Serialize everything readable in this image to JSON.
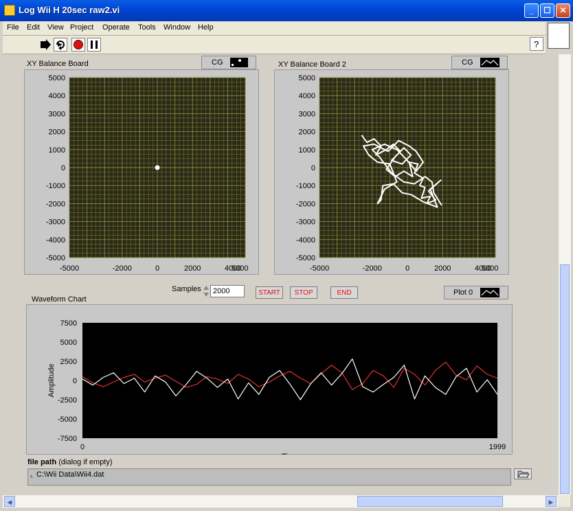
{
  "window": {
    "title": "Log Wii H 20sec raw2.vi",
    "controls": [
      "minimize-icon",
      "maximize-icon",
      "close-icon"
    ]
  },
  "menu": [
    "File",
    "Edit",
    "View",
    "Project",
    "Operate",
    "Tools",
    "Window",
    "Help"
  ],
  "toolbar": {
    "icons": [
      "run-arrow-icon",
      "run-continuously-icon",
      "abort-icon",
      "pause-icon"
    ],
    "help_icon": "help-icon"
  },
  "graph1": {
    "label": "XY Balance Board",
    "legend": "CG",
    "legend_icon": "point-plot-icon"
  },
  "graph2": {
    "label": "XY Balance Board 2",
    "legend": "CG",
    "legend_icon": "line-plot-icon"
  },
  "samples": {
    "label": "Samples",
    "value": "2000"
  },
  "buttons": {
    "start": "START",
    "stop": "STOP",
    "end": "END"
  },
  "waveform": {
    "label": "Waveform Chart",
    "legend": "Plot 0",
    "xlabel": "Time",
    "ylabel": "Amplitude",
    "x_start": "0",
    "x_end": "1999"
  },
  "filepath": {
    "label_bold": "file path",
    "label_rest": "(dialog if empty)",
    "value": "C:\\Wii Data\\Wii4.dat",
    "browse_icon": "folder-open-icon"
  },
  "chart_data": [
    {
      "type": "scatter",
      "title": "XY Balance Board",
      "xlim": [
        -5000,
        5000
      ],
      "ylim": [
        -5000,
        5000
      ],
      "xticks": [
        "-5000",
        "-2000",
        "0",
        "2000",
        "4000",
        "5000"
      ],
      "yticks": [
        "5000",
        "4000",
        "3000",
        "2000",
        "1000",
        "0",
        "-1000",
        "-2000",
        "-3000",
        "-4000",
        "-5000"
      ],
      "grid": true,
      "points": [
        [
          0,
          0
        ]
      ],
      "colors": {
        "plot_bg": "#2a2a18",
        "grid": "#8c8a3a",
        "series": "#ffffff"
      }
    },
    {
      "type": "line",
      "title": "XY Balance Board 2",
      "xlim": [
        -5000,
        5000
      ],
      "ylim": [
        -5000,
        5000
      ],
      "xticks": [
        "-5000",
        "-2000",
        "0",
        "2000",
        "4000",
        "5000"
      ],
      "yticks": [
        "5000",
        "4000",
        "3000",
        "2000",
        "1000",
        "0",
        "-1000",
        "-2000",
        "-3000",
        "-4000",
        "-5000"
      ],
      "grid": true,
      "trajectory": [
        [
          -2600,
          1800
        ],
        [
          -2300,
          1400
        ],
        [
          -1900,
          1600
        ],
        [
          -1500,
          1200
        ],
        [
          -1800,
          700
        ],
        [
          -1200,
          1000
        ],
        [
          -800,
          1300
        ],
        [
          -400,
          900
        ],
        [
          -900,
          400
        ],
        [
          -300,
          200
        ],
        [
          200,
          700
        ],
        [
          -200,
          1100
        ],
        [
          -700,
          600
        ],
        [
          -1200,
          -100
        ],
        [
          -700,
          -500
        ],
        [
          -200,
          -200
        ],
        [
          300,
          -500
        ],
        [
          100,
          300
        ],
        [
          600,
          200
        ],
        [
          400,
          -300
        ],
        [
          900,
          -600
        ],
        [
          700,
          -1000
        ],
        [
          1000,
          -1100
        ],
        [
          800,
          -1700
        ],
        [
          1300,
          -1600
        ],
        [
          1100,
          -2000
        ],
        [
          1600,
          -1800
        ],
        [
          1200,
          -1300
        ],
        [
          1900,
          -700
        ],
        [
          1300,
          -1200
        ],
        [
          1700,
          -2200
        ],
        [
          900,
          -1900
        ],
        [
          200,
          -1500
        ],
        [
          -300,
          -1400
        ],
        [
          -800,
          -900
        ],
        [
          -1400,
          -1000
        ],
        [
          -1500,
          -1800
        ],
        [
          -1700,
          -2000
        ],
        [
          -1300,
          -1200
        ],
        [
          -600,
          -800
        ],
        [
          -1000,
          200
        ],
        [
          -1700,
          300
        ],
        [
          -2200,
          700
        ],
        [
          -2500,
          1200
        ],
        [
          -1900,
          1300
        ],
        [
          -1100,
          900
        ],
        [
          -500,
          1500
        ],
        [
          100,
          1200
        ],
        [
          500,
          900
        ],
        [
          900,
          300
        ],
        [
          500,
          -200
        ],
        [
          -100,
          500
        ],
        [
          -600,
          1000
        ],
        [
          -1300,
          1300
        ],
        [
          -2000,
          1000
        ],
        [
          -1600,
          600
        ],
        [
          -900,
          -300
        ],
        [
          -200,
          -800
        ],
        [
          400,
          -900
        ],
        [
          1000,
          -500
        ],
        [
          1400,
          -800
        ],
        [
          1500,
          -1400
        ],
        [
          1950,
          -2100
        ]
      ],
      "colors": {
        "plot_bg": "#2a2a18",
        "grid": "#8c8a3a",
        "series": "#ffffff"
      }
    },
    {
      "type": "line",
      "title": "Waveform Chart",
      "xlabel": "Time",
      "ylabel": "Amplitude",
      "xlim": [
        0,
        1999
      ],
      "ylim": [
        -7500,
        7500
      ],
      "yticks": [
        "7500",
        "5000",
        "2500",
        "0",
        "-2500",
        "-5000",
        "-7500"
      ],
      "grid": false,
      "x": [
        0,
        50,
        100,
        150,
        200,
        250,
        300,
        350,
        400,
        450,
        500,
        550,
        600,
        650,
        700,
        750,
        800,
        850,
        900,
        950,
        1000,
        1050,
        1100,
        1150,
        1200,
        1250,
        1300,
        1350,
        1400,
        1450,
        1500,
        1550,
        1600,
        1650,
        1700,
        1750,
        1800,
        1850,
        1900,
        1950,
        1999
      ],
      "series": [
        {
          "color": "#e83030",
          "values": [
            500,
            -300,
            -800,
            -200,
            400,
            800,
            -200,
            300,
            700,
            -100,
            -900,
            -500,
            500,
            200,
            -400,
            800,
            200,
            -800,
            -200,
            600,
            1200,
            300,
            -400,
            900,
            2000,
            1000,
            -1200,
            -400,
            1300,
            600,
            -900,
            1600,
            800,
            -600,
            1300,
            2400,
            700,
            100,
            1900,
            800,
            300
          ]
        },
        {
          "color": "#ffffff",
          "values": [
            200,
            -600,
            400,
            1000,
            -400,
            300,
            -1500,
            600,
            -200,
            -2000,
            -500,
            1200,
            300,
            -900,
            200,
            -2400,
            -300,
            -1800,
            400,
            1300,
            -500,
            -2500,
            -400,
            1000,
            -600,
            900,
            2800,
            -800,
            -1500,
            -500,
            400,
            2000,
            -2400,
            600,
            -900,
            -1800,
            500,
            1600,
            -1500,
            100,
            -1800
          ]
        }
      ],
      "colors": {
        "plot_bg": "#000000"
      }
    }
  ]
}
